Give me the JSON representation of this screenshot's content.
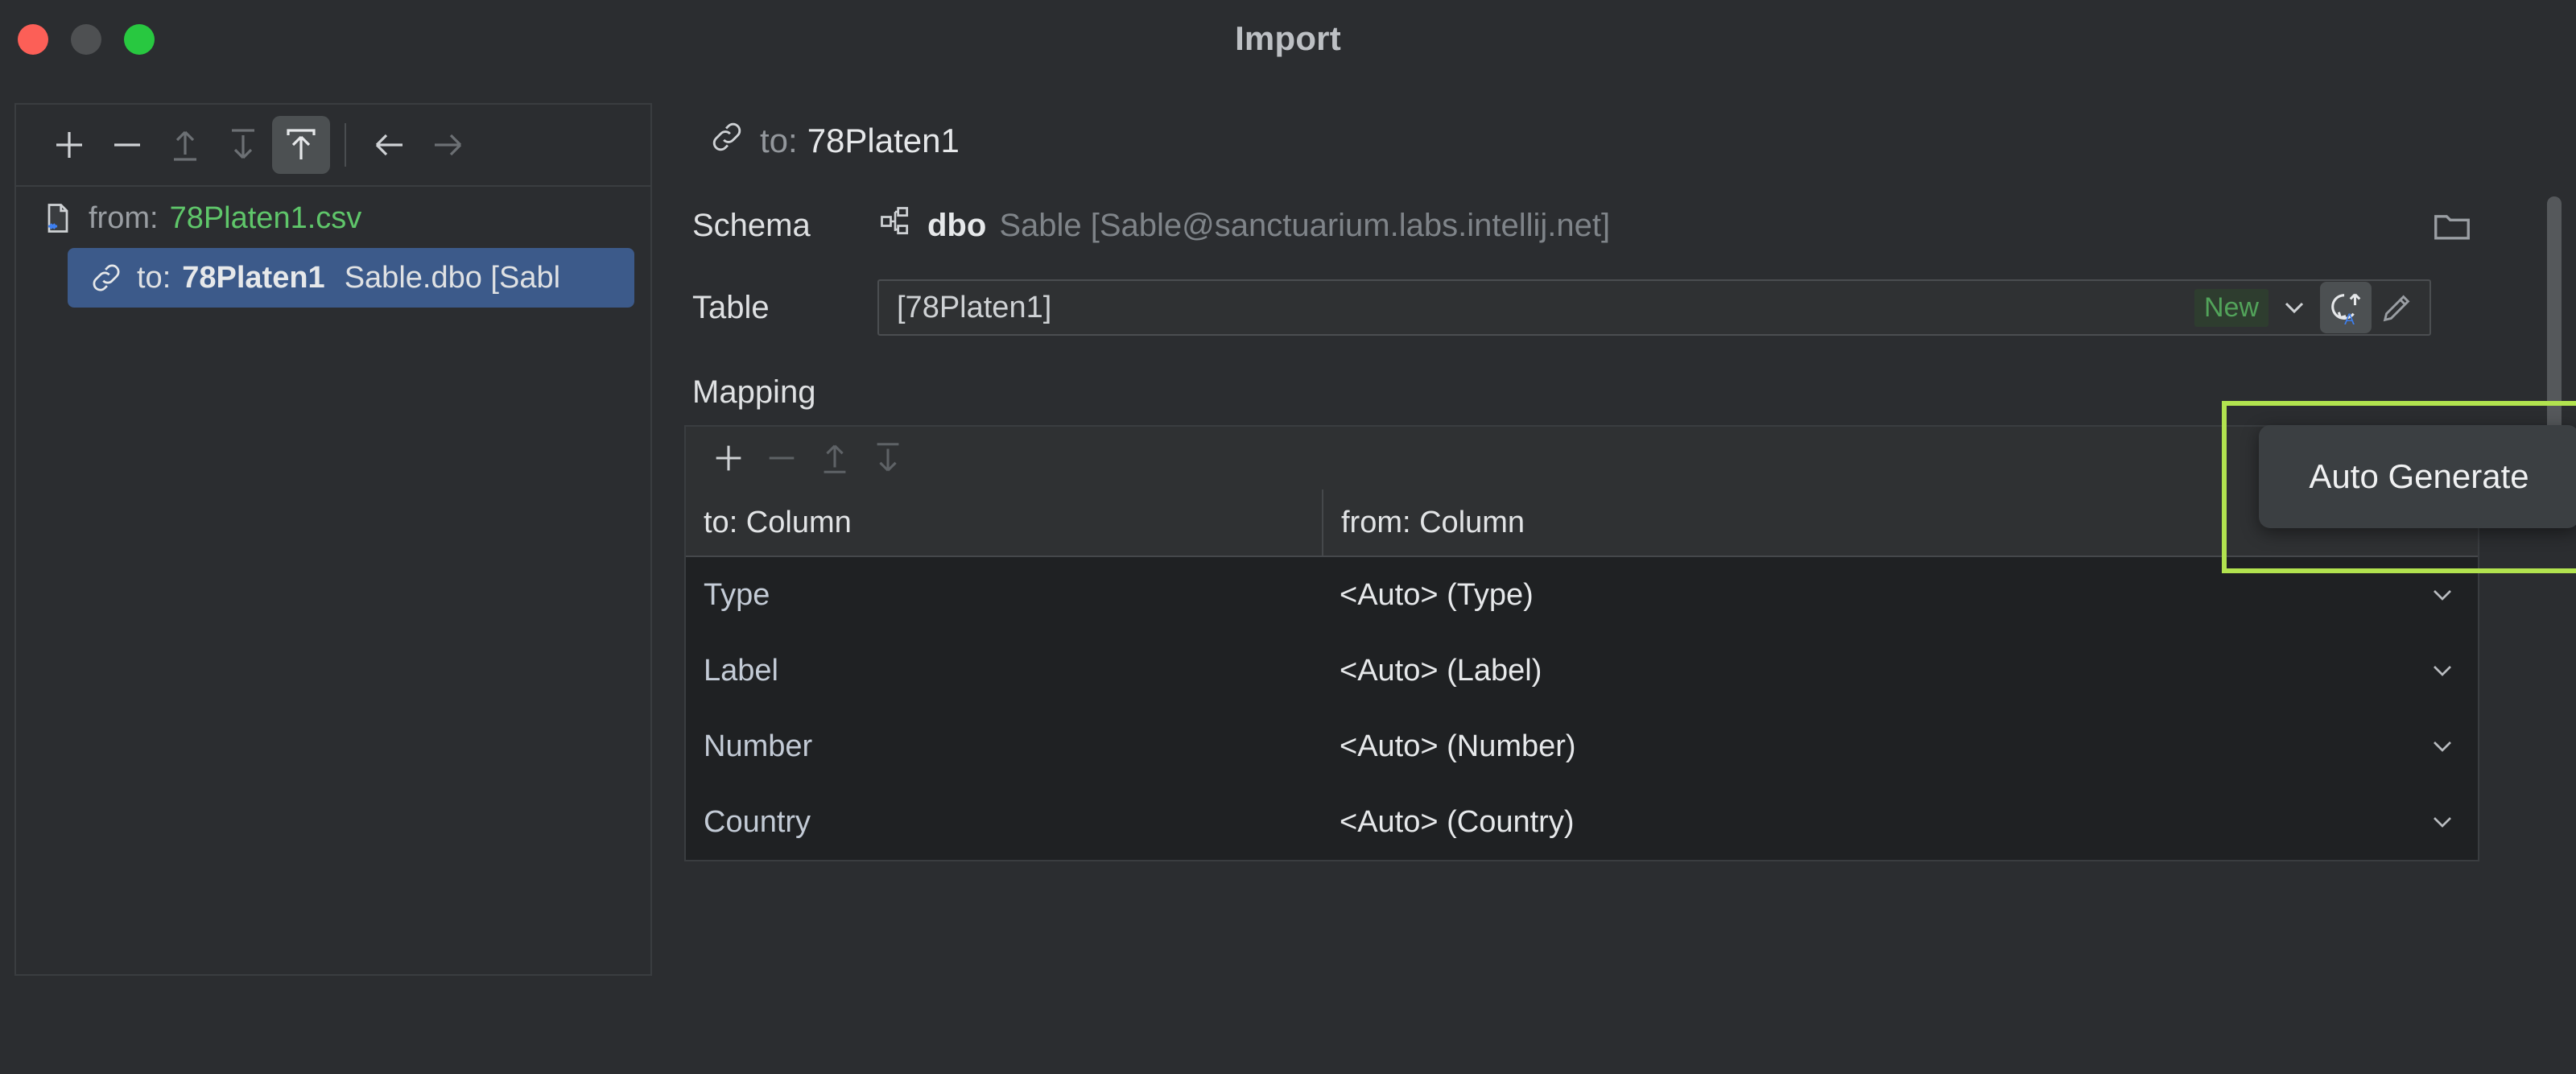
{
  "window": {
    "title": "Import",
    "traffic_lights": [
      "close-red",
      "minimize-yellow",
      "maximize-green"
    ]
  },
  "left_panel": {
    "toolbar": [
      {
        "name": "add-button",
        "icon": "plus-icon",
        "enabled": true,
        "active": false
      },
      {
        "name": "remove-button",
        "icon": "minus-icon",
        "enabled": true,
        "active": false
      },
      {
        "name": "move-up-button",
        "icon": "arrow-up-to-line-icon",
        "enabled": false,
        "active": false
      },
      {
        "name": "move-down-button",
        "icon": "arrow-down-to-line-icon",
        "enabled": false,
        "active": false
      },
      {
        "name": "import-to-button",
        "icon": "arrow-up-into-box-icon",
        "enabled": true,
        "active": true
      },
      {
        "name": "back-button",
        "icon": "arrow-left-icon",
        "enabled": true,
        "active": false
      },
      {
        "name": "forward-button",
        "icon": "arrow-right-icon",
        "enabled": false,
        "active": false
      }
    ],
    "tree": [
      {
        "icon": "csv-file-icon",
        "prefix": "from:",
        "label": "78Platen1.csv",
        "selected": false
      },
      {
        "icon": "link-icon",
        "prefix": "to:",
        "label": "78Platen1",
        "detail": "Sable.dbo [Sabl",
        "selected": true
      }
    ]
  },
  "right_panel": {
    "target_header": {
      "icon": "link-icon",
      "prefix": "to:",
      "value": "78Platen1"
    },
    "schema": {
      "label": "Schema",
      "icon": "schema-icon",
      "name": "dbo",
      "path": "Sable [Sable@sanctuarium.labs.intellij.net]",
      "browse_icon": "folder-icon"
    },
    "table": {
      "label": "Table",
      "value": "[78Platen1]",
      "placeholder": "[78Platen1]",
      "status_badge": "New",
      "dropdown_icon": "chevron-down-icon",
      "refresh_icon": "auto-generate-icon",
      "edit_icon": "pencil-icon"
    },
    "mapping": {
      "label": "Mapping",
      "toolbar": [
        {
          "name": "add-mapping-button",
          "icon": "plus-icon",
          "enabled": true
        },
        {
          "name": "remove-mapping-button",
          "icon": "minus-icon",
          "enabled": false
        },
        {
          "name": "mapping-move-up-button",
          "icon": "arrow-up-to-line-icon",
          "enabled": false
        },
        {
          "name": "mapping-move-down-button",
          "icon": "arrow-down-to-line-icon",
          "enabled": false
        }
      ],
      "columns": [
        "to: Column",
        "from: Column"
      ],
      "rows": [
        {
          "to": "Type",
          "from": "<Auto> (Type)"
        },
        {
          "to": "Label",
          "from": "<Auto> (Label)"
        },
        {
          "to": "Number",
          "from": "<Auto> (Number)"
        },
        {
          "to": "Country",
          "from": "<Auto> (Country)"
        }
      ]
    }
  },
  "tooltip": {
    "text": "Auto Generate"
  },
  "colors": {
    "background": "#2b2d30",
    "panel_border": "#3a3d40",
    "selection_blue": "#3c5a8a",
    "accent_green": "#5fc66a",
    "badge_green": "#52a35a",
    "highlight_green": "#b2e34f",
    "table_body": "#1f2123",
    "text_primary": "#e6e8ea",
    "text_muted": "#7f8489"
  }
}
